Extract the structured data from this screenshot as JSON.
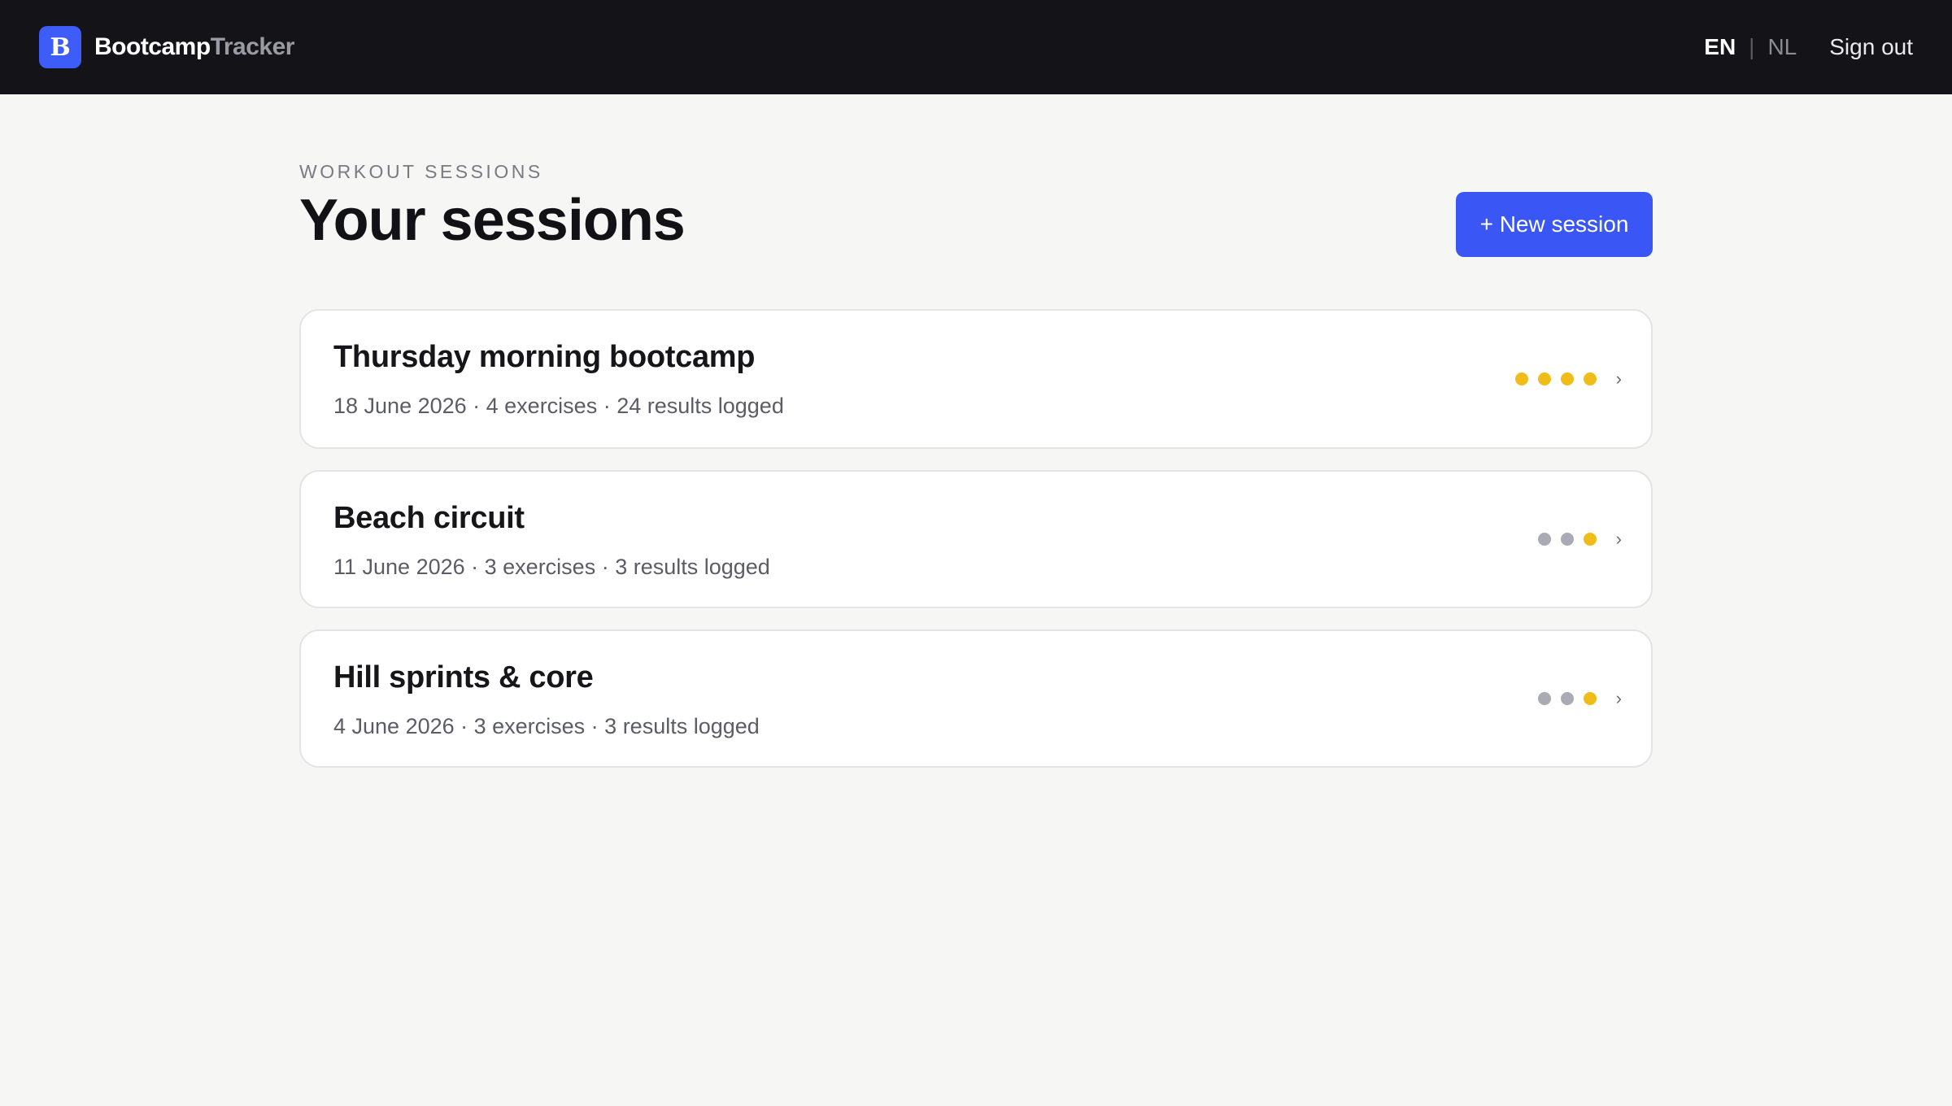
{
  "brand": {
    "logo_letter": "B",
    "name_part1": "Bootcamp",
    "name_part2": "Tracker"
  },
  "nav": {
    "lang_en": "EN",
    "lang_separator": "|",
    "lang_nl": "NL",
    "active_lang": "EN",
    "sign_out": "Sign out"
  },
  "page": {
    "eyebrow": "WORKOUT SESSIONS",
    "title": "Your sessions",
    "new_session_button": "+ New session"
  },
  "colors": {
    "topbar": "#141418",
    "accent": "#3a57f6",
    "rating_on": "#f0bd18",
    "rating_off": "#a9aab4",
    "background": "#f6f6f5"
  },
  "sessions": [
    {
      "title": "Thursday morning bootcamp",
      "meta": "18 June 2026 · 4 exercises · 24 results logged",
      "dots": [
        "on",
        "on",
        "on",
        "on"
      ]
    },
    {
      "title": "Beach circuit",
      "meta": "11 June 2026 · 3 exercises · 3 results logged",
      "dots": [
        "off",
        "off",
        "on"
      ]
    },
    {
      "title": "Hill sprints & core",
      "meta": "4 June 2026 · 3 exercises · 3 results logged",
      "dots": [
        "off",
        "off",
        "on"
      ]
    }
  ],
  "icons": {
    "chevron": "chevron-right-icon",
    "chevron_glyph": "›"
  }
}
